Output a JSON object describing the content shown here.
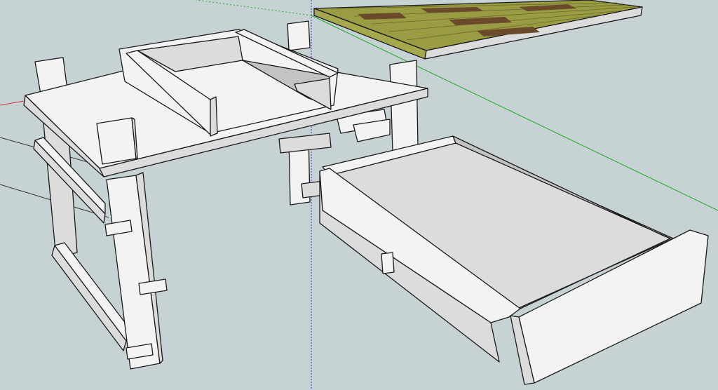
{
  "scene": {
    "background_color": "#c6d2d4",
    "axis_colors": {
      "red": "#cc3333",
      "green": "#22aa22",
      "blue": "#3333cc"
    },
    "face_colors": {
      "lit": "#f3f3f3",
      "mid": "#dcdcdc",
      "shade": "#c3c3c3",
      "dark": "#b3b3b3"
    },
    "plank_colors": {
      "light": "#a4a64a",
      "dark": "#6a4a2a"
    },
    "objects": [
      "desk-frame",
      "desk-top-panel",
      "back-box",
      "front-right-leg",
      "drawer-extended",
      "floorboard-panel",
      "leader-lines"
    ]
  }
}
